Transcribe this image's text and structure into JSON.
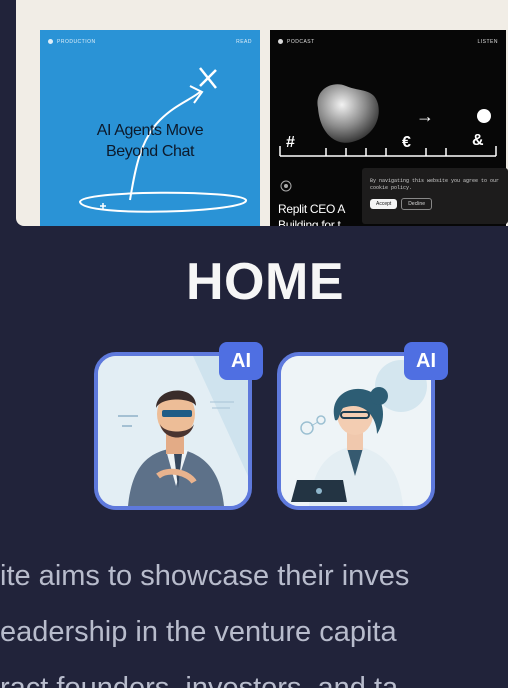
{
  "preview": {
    "card_blue": {
      "category": "PRODUCTION",
      "tag": "READ",
      "headline_line1": "AI Agents Move",
      "headline_line2": "Beyond Chat"
    },
    "card_black": {
      "category": "PODCAST",
      "tag": "LISTEN",
      "title_line1": "Replit CEO A",
      "title_line2": "Building for t",
      "symbols": [
        "#",
        "€",
        "&"
      ],
      "arrow": "→"
    },
    "cookie_banner": {
      "text": "By navigating this website you agree to our cookie policy.",
      "accept_label": "Accept",
      "decline_label": "Decline"
    }
  },
  "page_title": "HOME",
  "badges": {
    "ai_label_1": "AI",
    "ai_label_2": "AI"
  },
  "description": {
    "line1": "ite aims to showcase their inves",
    "line2": "eadership in the venture capita",
    "line3": "ract founders, investors, and ta"
  },
  "colors": {
    "background": "#21233a",
    "accent": "#5e79dc",
    "badge": "#4f6fe2",
    "card_blue": "#2a93d6"
  }
}
